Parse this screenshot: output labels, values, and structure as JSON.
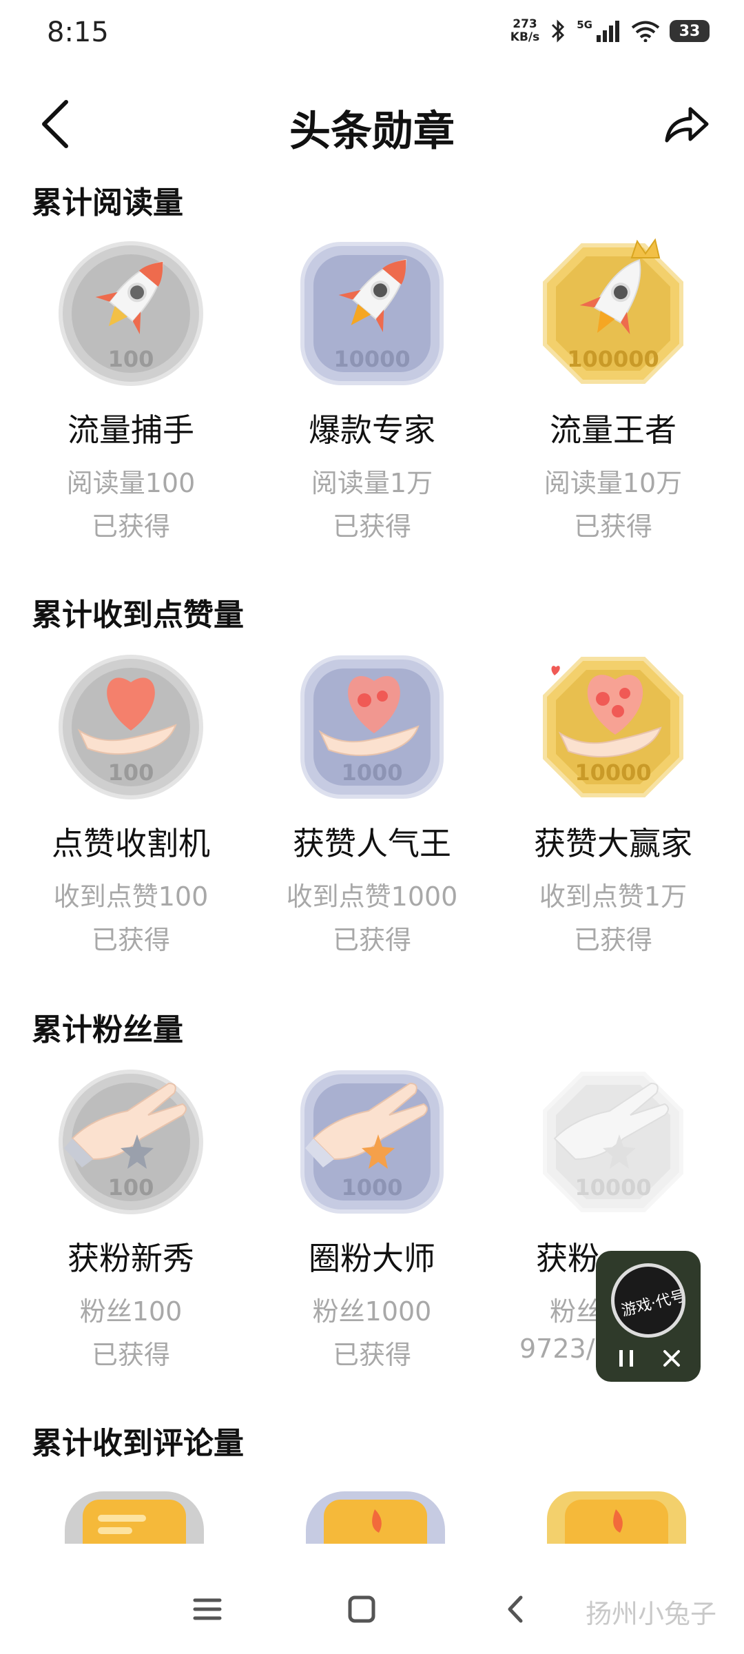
{
  "status_bar": {
    "time": "8:15",
    "net_speed_value": "273",
    "net_speed_unit": "KB/s",
    "signal_type": "5G",
    "battery": "33"
  },
  "header": {
    "title": "头条勋章"
  },
  "sections": [
    {
      "title": "累计阅读量",
      "badges": [
        {
          "name": "流量捕手",
          "condition": "阅读量100",
          "status": "已获得",
          "number": "100",
          "tier": "silver",
          "shape": "circle",
          "theme": "rocket-icon"
        },
        {
          "name": "爆款专家",
          "condition": "阅读量1万",
          "status": "已获得",
          "number": "10000",
          "tier": "blue",
          "shape": "rounded-square",
          "theme": "rocket-icon"
        },
        {
          "name": "流量王者",
          "condition": "阅读量10万",
          "status": "已获得",
          "number": "100000",
          "tier": "gold",
          "shape": "octagon",
          "theme": "crowned-rocket-icon"
        }
      ]
    },
    {
      "title": "累计收到点赞量",
      "badges": [
        {
          "name": "点赞收割机",
          "condition": "收到点赞100",
          "status": "已获得",
          "number": "100",
          "tier": "silver",
          "shape": "circle",
          "theme": "heart-hand-icon"
        },
        {
          "name": "获赞人气王",
          "condition": "收到点赞1000",
          "status": "已获得",
          "number": "1000",
          "tier": "blue",
          "shape": "rounded-square",
          "theme": "heart-hand-icon"
        },
        {
          "name": "获赞大赢家",
          "condition": "收到点赞1万",
          "status": "已获得",
          "number": "10000",
          "tier": "gold",
          "shape": "octagon",
          "theme": "heart-hand-icon"
        }
      ]
    },
    {
      "title": "累计粉丝量",
      "badges": [
        {
          "name": "获粉新秀",
          "condition": "粉丝100",
          "status": "已获得",
          "number": "100",
          "tier": "silver",
          "shape": "circle",
          "theme": "star-hand-icon"
        },
        {
          "name": "圈粉大师",
          "condition": "粉丝1000",
          "status": "已获得",
          "number": "1000",
          "tier": "blue",
          "shape": "rounded-square",
          "theme": "star-hand-icon"
        },
        {
          "name": "获粉",
          "condition": "粉丝",
          "status": "9723/",
          "number": "10000",
          "tier": "locked",
          "shape": "octagon",
          "theme": "star-hand-icon"
        }
      ]
    },
    {
      "title": "累计收到评论量",
      "badges": []
    }
  ],
  "mini_player": {
    "cover_text": "游戏·代号永夜"
  },
  "watermark": "扬州小兔子",
  "colors": {
    "silver": "#c9c9c9",
    "blue": "#b6bdd8",
    "gold": "#f0c95a",
    "locked": "#ececec",
    "rocket": "#ee6b4d",
    "heart": "#f27a6a"
  }
}
